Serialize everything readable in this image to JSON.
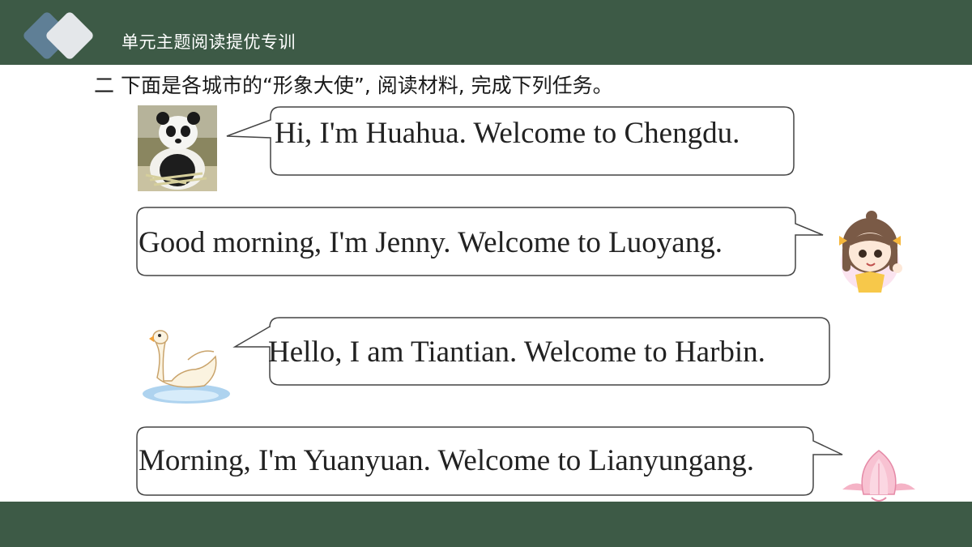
{
  "header": {
    "title": "单元主题阅读提优专训"
  },
  "instruction": "二 下面是各城市的“形象大使”, 阅读材料, 完成下列任务。",
  "bubbles": [
    {
      "text": "Hi, I'm Huahua. Welcome to Chengdu.",
      "avatar_icon": "panda-icon"
    },
    {
      "text": "Good morning, I'm Jenny. Welcome to Luoyang.",
      "avatar_icon": "girl-icon"
    },
    {
      "text": "Hello, I am Tiantian. Welcome to Harbin.",
      "avatar_icon": "swan-icon"
    },
    {
      "text": "Morning, I'm Yuanyuan. Welcome to Lianyungang.",
      "avatar_icon": "lotus-icon"
    }
  ],
  "colors": {
    "bar": "#3d5a46",
    "logo_front": "#d9dde0",
    "logo_back": "#5f7f96",
    "bubble_border": "#444444"
  }
}
